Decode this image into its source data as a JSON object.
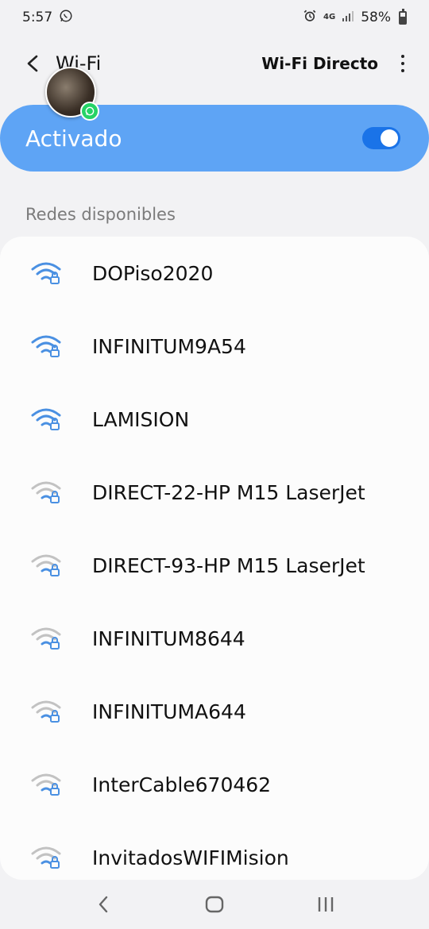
{
  "status_bar": {
    "time": "5:57",
    "network_type": "4G",
    "battery": "58%"
  },
  "toolbar": {
    "title": "Wi-Fi",
    "wifi_direct_label": "Wi-Fi Directo"
  },
  "toggle_card": {
    "label": "Activado",
    "enabled": true
  },
  "section": {
    "label": "Redes disponibles"
  },
  "networks": [
    {
      "name": "DOPiso2020",
      "signal": "strong",
      "secured": true
    },
    {
      "name": "INFINITUM9A54",
      "signal": "strong",
      "secured": true
    },
    {
      "name": "LAMISION",
      "signal": "strong",
      "secured": true
    },
    {
      "name": "DIRECT-22-HP M15 LaserJet",
      "signal": "weak",
      "secured": true
    },
    {
      "name": "DIRECT-93-HP M15 LaserJet",
      "signal": "weak",
      "secured": true
    },
    {
      "name": "INFINITUM8644",
      "signal": "weak",
      "secured": true
    },
    {
      "name": "INFINITUMA644",
      "signal": "weak",
      "secured": true
    },
    {
      "name": "InterCable670462",
      "signal": "weak",
      "secured": true
    },
    {
      "name": "InvitadosWIFIMision",
      "signal": "weak",
      "secured": true
    }
  ],
  "colors": {
    "accent": "#1a73e8",
    "card": "#5ea4f5",
    "wifi_strong": "#4a90e2",
    "wifi_weak": "#b8b8b8"
  }
}
